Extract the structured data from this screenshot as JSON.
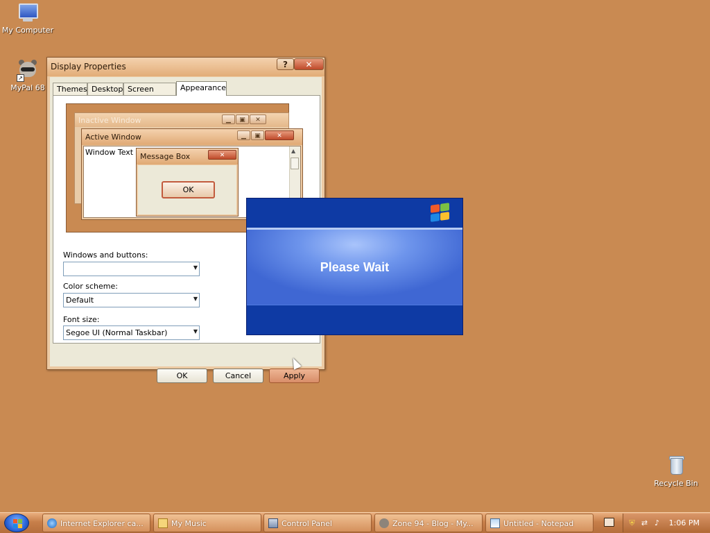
{
  "desktop": {
    "icons": [
      {
        "label": "My Computer",
        "icon": "computer-icon"
      },
      {
        "label": "MyPal 68",
        "icon": "raccoon-icon"
      },
      {
        "label": "Recycle Bin",
        "icon": "recycle-bin-icon"
      }
    ],
    "background_color": "#c98a52"
  },
  "display_properties": {
    "title": "Display Properties",
    "help_label": "?",
    "close_label": "✕",
    "tabs": [
      {
        "label": "Themes"
      },
      {
        "label": "Desktop"
      },
      {
        "label": "Screen Saver"
      },
      {
        "label": "Appearance",
        "active": true
      }
    ],
    "preview": {
      "inactive_title": "Inactive Window",
      "active_title": "Active Window",
      "window_text": "Window Text",
      "message_box_title": "Message Box",
      "message_box_ok": "OK",
      "minimize_glyph": "▁",
      "maximize_glyph": "▣",
      "close_glyph": "✕"
    },
    "fields": {
      "windows_buttons_label": "Windows and buttons:",
      "windows_buttons_value": "",
      "color_scheme_label": "Color scheme:",
      "color_scheme_value": "Default",
      "font_size_label": "Font size:",
      "font_size_value": "Segoe UI (Normal Taskbar)",
      "dropdown_glyph": "▼"
    },
    "buttons": {
      "ok": "OK",
      "cancel": "Cancel",
      "apply": "Apply"
    }
  },
  "please_wait": {
    "text": "Please Wait",
    "accent": "#0e3aa4"
  },
  "taskbar": {
    "items": [
      {
        "label": "Internet Explorer ca...",
        "icon": "ie-icon"
      },
      {
        "label": "My Music",
        "icon": "folder-music-icon"
      },
      {
        "label": "Control Panel",
        "icon": "control-panel-icon"
      },
      {
        "label": "Zone 94 - Blog - My...",
        "icon": "raccoon-icon"
      },
      {
        "label": "Untitled - Notepad",
        "icon": "notepad-icon"
      }
    ],
    "clock": "1:06 PM"
  }
}
